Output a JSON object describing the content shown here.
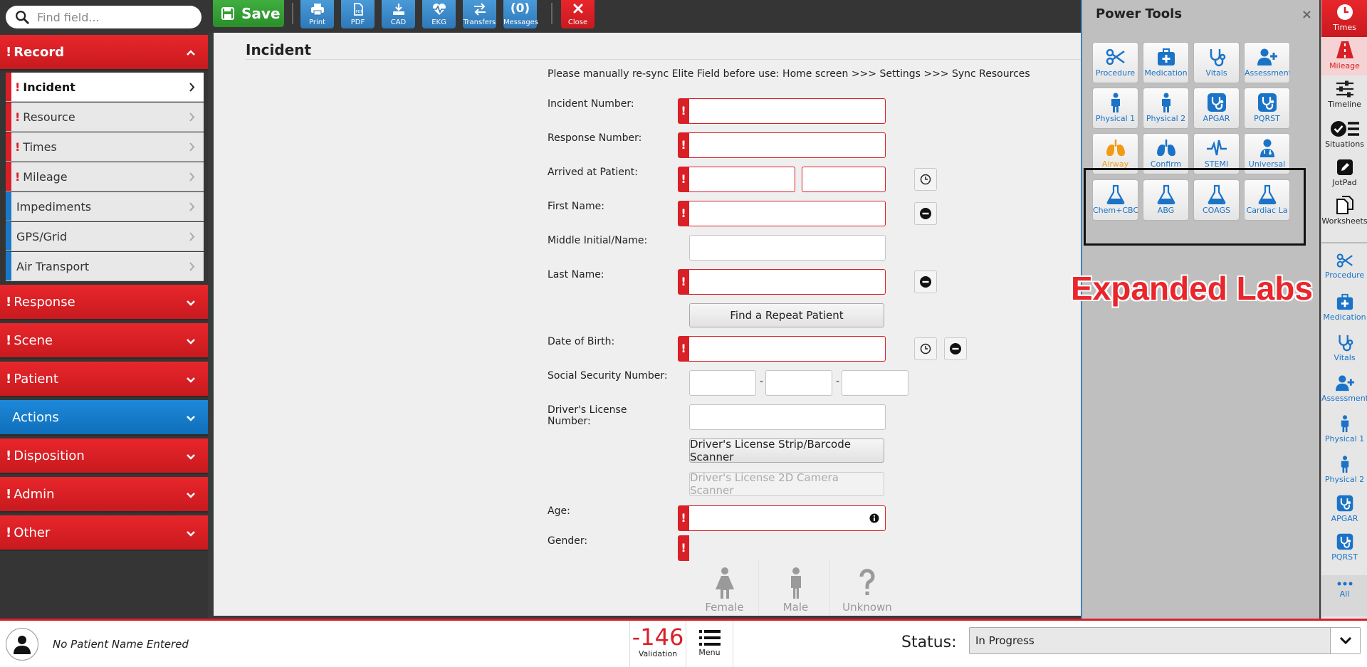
{
  "search": {
    "placeholder": "Find field..."
  },
  "sidebar": {
    "record": {
      "label": "Record",
      "required": true
    },
    "record_items": [
      {
        "label": "Incident",
        "required": true,
        "active": true
      },
      {
        "label": "Resource",
        "required": true
      },
      {
        "label": "Times",
        "required": true
      },
      {
        "label": "Mileage",
        "required": true
      },
      {
        "label": "Impediments",
        "required": false
      },
      {
        "label": "GPS/Grid",
        "required": false
      },
      {
        "label": "Air Transport",
        "required": false
      }
    ],
    "sections": [
      {
        "label": "Response",
        "required": true
      },
      {
        "label": "Scene",
        "required": true
      },
      {
        "label": "Patient",
        "required": true
      },
      {
        "label": "Actions",
        "required": false
      },
      {
        "label": "Disposition",
        "required": true
      },
      {
        "label": "Admin",
        "required": true
      },
      {
        "label": "Other",
        "required": true
      }
    ]
  },
  "toolbar": {
    "save": "Save",
    "buttons": [
      {
        "label": "Print",
        "icon": "print-icon"
      },
      {
        "label": "PDF",
        "icon": "pdf-icon"
      },
      {
        "label": "CAD",
        "icon": "download-icon"
      },
      {
        "label": "EKG",
        "icon": "heartbeat-icon"
      },
      {
        "label": "Transfers",
        "icon": "transfer-icon"
      },
      {
        "label": "Messages",
        "count": "(0)"
      }
    ],
    "close": "Close"
  },
  "form": {
    "title": "Incident",
    "notice": "Please manually re-sync Elite Field before use: Home screen >>> Settings >>> Sync Resources",
    "labels": {
      "incident_number": "Incident Number:",
      "response_number": "Response Number:",
      "arrived_at_patient": "Arrived at Patient:",
      "first_name": "First Name:",
      "middle_name": "Middle Initial/Name:",
      "last_name": "Last Name:",
      "date_of_birth": "Date of Birth:",
      "ssn": "Social Security Number:",
      "drivers_license_1": "Driver's License",
      "drivers_license_2": "Number:",
      "age": "Age:",
      "gender": "Gender:"
    },
    "buttons": {
      "find_repeat": "Find a Repeat Patient",
      "dl_scanner": "Driver's License Strip/Barcode Scanner",
      "dl_camera": "Driver's License 2D Camera Scanner"
    },
    "ssn_sep": "-",
    "gender_options": [
      "Female",
      "Male",
      "Unknown"
    ]
  },
  "power_tools": {
    "title": "Power Tools",
    "close": "×",
    "tiles": [
      {
        "label": "Procedure",
        "icon": "scissors-icon"
      },
      {
        "label": "Medication",
        "icon": "medkit-icon"
      },
      {
        "label": "Vitals",
        "icon": "stethoscope-icon"
      },
      {
        "label": "Assessment",
        "icon": "user-plus-icon"
      },
      {
        "label": "Physical 1",
        "icon": "person-icon"
      },
      {
        "label": "Physical 2",
        "icon": "person-icon"
      },
      {
        "label": "APGAR",
        "icon": "stethoscope-box-icon"
      },
      {
        "label": "PQRST",
        "icon": "stethoscope-box-icon"
      },
      {
        "label": "Airway",
        "icon": "lungs-icon",
        "color": "#f39a12"
      },
      {
        "label": "Confirm",
        "icon": "lungs-icon"
      },
      {
        "label": "STEMI",
        "icon": "heartbeat-icon"
      },
      {
        "label": "Universal",
        "icon": "doctor-icon"
      },
      {
        "label": "Chem+CBC",
        "icon": "flask-icon"
      },
      {
        "label": "ABG",
        "icon": "flask-icon"
      },
      {
        "label": "COAGS",
        "icon": "flask-icon"
      },
      {
        "label": "Cardiac La",
        "icon": "flask-icon"
      }
    ],
    "annotation": "Expanded Labs"
  },
  "rail": {
    "items": [
      "Times",
      "Mileage",
      "Timeline",
      "Situations",
      "JotPad",
      "Worksheets",
      "Procedure",
      "Medication",
      "Vitals",
      "Assessment",
      "Physical 1",
      "Physical 2",
      "APGAR",
      "PQRST",
      "All"
    ]
  },
  "bottom": {
    "patient_name": "No Patient Name Entered",
    "validation_count": "-146",
    "validation_label": "Validation",
    "menu_label": "Menu",
    "status_label": "Status:",
    "status_value": "In Progress"
  },
  "colors": {
    "brand_red": "#d92027",
    "action_blue": "#1a73c7",
    "save_green": "#2a8f2a",
    "airway_orange": "#f39a12"
  }
}
